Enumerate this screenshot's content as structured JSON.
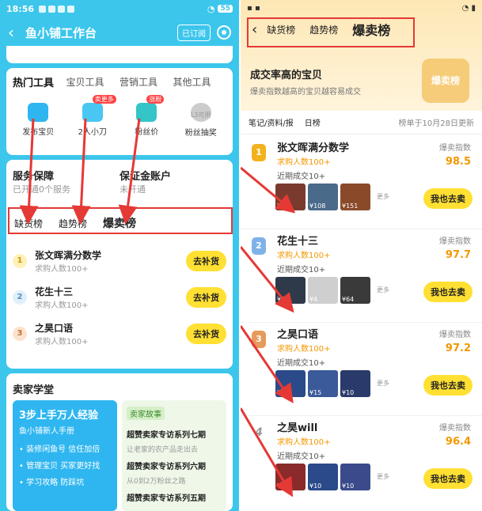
{
  "left": {
    "status": {
      "time": "18:56",
      "battery": "55"
    },
    "nav": {
      "title": "鱼小铺工作台",
      "subscribe": "已订阅"
    },
    "tool_tabs": [
      "热门工具",
      "宝贝工具",
      "营销工具",
      "其他工具"
    ],
    "tools": [
      {
        "label": "发布宝贝",
        "badge": ""
      },
      {
        "label": "2人小刀",
        "badge": "卖更多"
      },
      {
        "label": "粉丝价",
        "badge": "涨粉"
      },
      {
        "label": "粉丝抽奖",
        "badge": "",
        "note": "L3可用"
      }
    ],
    "service": {
      "title": "服务保障",
      "sub": "已开通0个服务"
    },
    "deposit": {
      "title": "保证金账户",
      "sub": "未开通"
    },
    "rank_tabs": [
      "缺货榜",
      "趋势榜",
      "爆卖榜"
    ],
    "ranks": [
      {
        "num": "1",
        "name": "张文晖满分数学",
        "sub": "求购人数100+",
        "btn": "去补货"
      },
      {
        "num": "2",
        "name": "花生十三",
        "sub": "求购人数100+",
        "btn": "去补货"
      },
      {
        "num": "3",
        "name": "之昊口语",
        "sub": "求购人数100+",
        "btn": "去补货"
      }
    ],
    "school": {
      "title": "卖家学堂",
      "promo_title": "3步上手万人经验",
      "promo_sub": "鱼小铺新人手册",
      "promo_items": [
        "• 装修闲鱼号 信任加倍",
        "• 管理宝贝 买家更好找",
        "• 学习攻略 防踩坑"
      ],
      "story_label": "卖家故事",
      "stories": [
        {
          "title": "超赞卖家专访系列七期",
          "sub": "让老家的农产品走出去"
        },
        {
          "title": "超赞卖家专访系列六期",
          "sub": "从0到2万粉丝之路"
        },
        {
          "title": "超赞卖家专访系列五期",
          "sub": ""
        }
      ]
    }
  },
  "right": {
    "tabs": [
      "缺货榜",
      "趋势榜",
      "爆卖榜"
    ],
    "header_title": "成交率高的宝贝",
    "header_sub": "爆卖指数越高的宝贝越容易成交",
    "badge": "爆卖榜",
    "filter1": "笔记/资料/报",
    "filter2": "日榜",
    "updated": "榜单于10月28日更新",
    "index_label": "爆卖指数",
    "items": [
      {
        "num": "1",
        "name": "张文晖满分数学",
        "want": "求购人数100+",
        "deal": "近期成交10+",
        "index": "98.5",
        "prices": [
          "¥60",
          "¥108",
          "¥151"
        ],
        "more": "更多",
        "btn": "我也去卖"
      },
      {
        "num": "2",
        "name": "花生十三",
        "want": "求购人数100+",
        "deal": "近期成交10+",
        "index": "97.7",
        "prices": [
          "¥98",
          "¥4",
          "¥64"
        ],
        "more": "更多",
        "btn": "我也去卖"
      },
      {
        "num": "3",
        "name": "之昊口语",
        "want": "求购人数100+",
        "deal": "近期成交10+",
        "index": "97.2",
        "prices": [
          "¥6",
          "¥15",
          "¥10"
        ],
        "more": "更多",
        "btn": "我也去卖"
      },
      {
        "num": "4",
        "name": "之昊will",
        "want": "求购人数100+",
        "deal": "近期成交10+",
        "index": "96.4",
        "prices": [
          "¥1",
          "¥10",
          "¥10"
        ],
        "more": "更多",
        "btn": "我也去卖"
      }
    ]
  },
  "colors": {
    "left_bg": "#3cc6ec",
    "accent_yellow": "#ffe033",
    "orange": "#f39800",
    "red": "#e53935"
  }
}
